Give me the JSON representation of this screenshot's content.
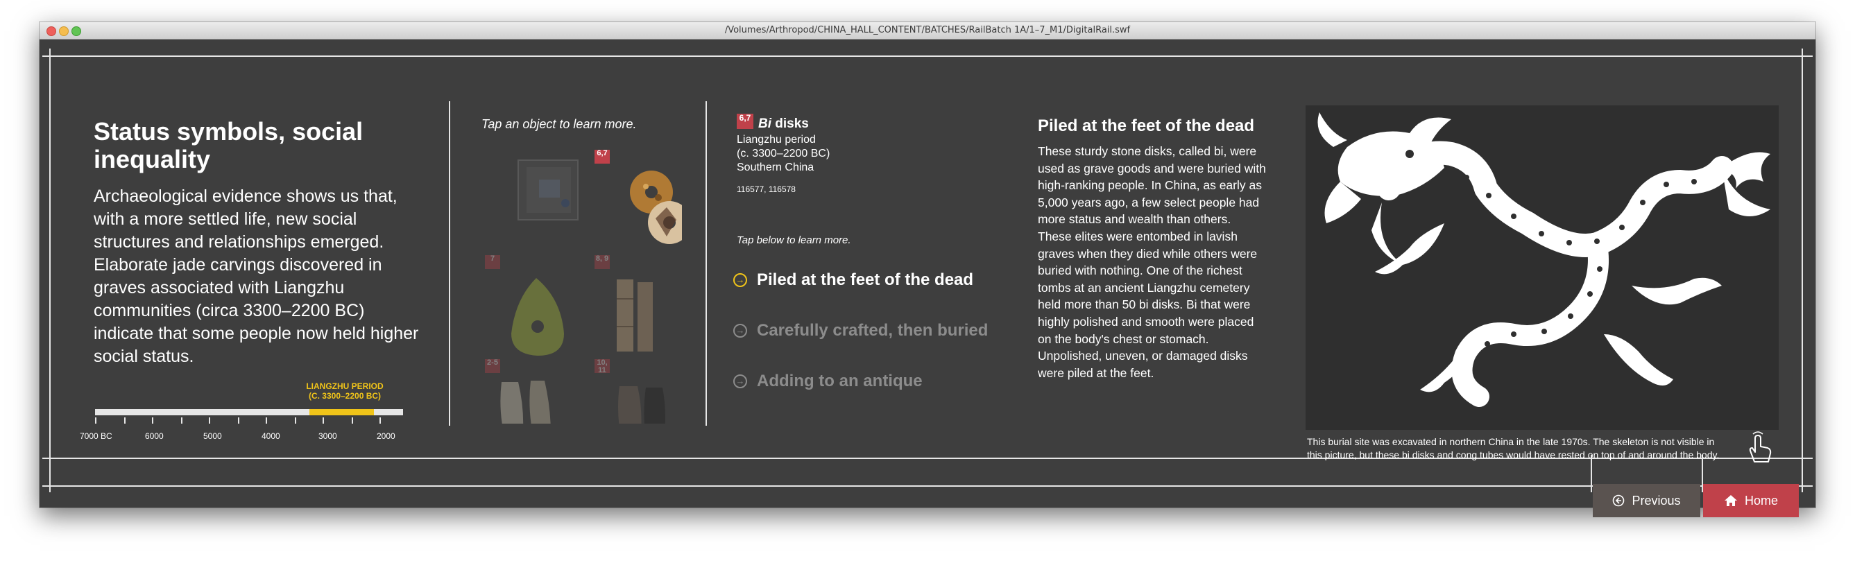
{
  "window": {
    "path": "/Volumes/Arthropod/CHINA_HALL_CONTENT/BATCHES/RailBatch 1A/1–7_M1/DigitalRail.swf"
  },
  "section": {
    "heading": "Status symbols, social inequality",
    "intro": "Archaeological evidence shows us that, with a more settled life, new social structures and relationships emerged. Elaborate jade carvings discovered in graves associated with Liangzhu communities (circa 3300–2200 BC) indicate that some people now held higher social status."
  },
  "timeline": {
    "period_label_1": "LIANGZHU PERIOD",
    "period_label_2": "(C. 3300–2200 BC)",
    "ticks": [
      "7000 BC",
      "6000",
      "5000",
      "4000",
      "3000",
      "2000"
    ],
    "highlight_start_bc": 3300,
    "highlight_end_bc": 2200,
    "highlight_color": "#f0c419"
  },
  "objects": {
    "prompt": "Tap an object to learn more.",
    "badges": [
      "6,7",
      "7",
      "8, 9",
      "2-5",
      "10, 11"
    ]
  },
  "detail": {
    "badge": "6,7",
    "title_italic": "Bi",
    "title_rest": " disks",
    "period": "Liangzhu period",
    "dates": "(c. 3300–2200 BC)",
    "region": "Southern China",
    "catalog": "116577, 116578",
    "prompt": "Tap below to learn more."
  },
  "topics": [
    {
      "label": "Piled at the feet of the dead"
    },
    {
      "label": "Carefully crafted, then buried"
    },
    {
      "label": "Adding to an antique"
    }
  ],
  "story": {
    "title": "Piled at the feet of the dead",
    "lines": [
      "These sturdy stone disks, called bi, were",
      "used as grave goods and were buried with",
      "high-ranking people. In China, as early as",
      "5,000 years ago, a few select people had",
      "more status and wealth than others.",
      "These elites were entombed in lavish",
      "graves when they died while others were",
      "buried with nothing. One of the richest",
      "tombs at an ancient Liangzhu cemetery",
      "held more than 50 bi disks. Bi that were",
      "highly polished and smooth were placed",
      "on the body's chest or stomach.",
      "Unpolished, uneven, or damaged disks",
      "were piled at the feet."
    ]
  },
  "photo": {
    "caption_1": "This burial site was excavated in northern China in the late 1970s. The skeleton is not visible in",
    "caption_2": "this picture, but these bi disks and cong tubes would have rested on top of and around the body."
  },
  "nav": {
    "previous": "Previous",
    "home": "Home"
  },
  "colors": {
    "background": "#3e3e3e",
    "accent_red": "#c0414a",
    "accent_yellow": "#f0c419"
  }
}
